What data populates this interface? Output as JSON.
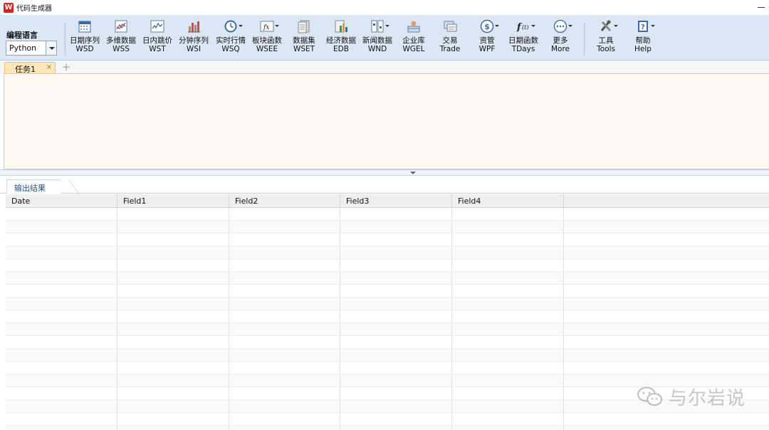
{
  "window": {
    "logo_letter": "W",
    "title": "代码生成器"
  },
  "ribbon": {
    "language_label": "编程语言",
    "language_value": "Python",
    "buttons": [
      {
        "label": "日期序列",
        "sub": "WSD",
        "icon": "calendar-grid-icon",
        "dropdown": false
      },
      {
        "label": "多维数据",
        "sub": "WSS",
        "icon": "multi-dimension-chart-icon",
        "dropdown": false
      },
      {
        "label": "日内跳价",
        "sub": "WST",
        "icon": "intraday-tick-icon",
        "dropdown": false
      },
      {
        "label": "分钟序列",
        "sub": "WSI",
        "icon": "bar-chart-icon",
        "dropdown": false
      },
      {
        "label": "实时行情",
        "sub": "WSQ",
        "icon": "clock-icon",
        "dropdown": true
      },
      {
        "label": "板块函数",
        "sub": "WSEE",
        "icon": "function-fx-icon",
        "dropdown": true
      },
      {
        "label": "数据集",
        "sub": "WSET",
        "icon": "dataset-stack-icon",
        "dropdown": false
      },
      {
        "label": "经济数据",
        "sub": "EDB",
        "icon": "economic-data-icon",
        "dropdown": false
      },
      {
        "label": "新闻数据",
        "sub": "WND",
        "icon": "news-icon",
        "dropdown": true
      },
      {
        "label": "企业库",
        "sub": "WGEL",
        "icon": "enterprise-library-icon",
        "dropdown": false
      },
      {
        "label": "交易",
        "sub": "Trade",
        "icon": "trade-window-icon",
        "dropdown": false
      },
      {
        "label": "资管",
        "sub": "WPF",
        "icon": "dollar-circle-icon",
        "dropdown": true
      },
      {
        "label": "日期函数",
        "sub": "TDays",
        "icon": "date-function-icon",
        "dropdown": true
      },
      {
        "label": "更多",
        "sub": "More",
        "icon": "more-ellipsis-icon",
        "dropdown": true
      },
      {
        "label": "工具",
        "sub": "Tools",
        "icon": "tools-wrench-icon",
        "dropdown": true
      },
      {
        "label": "帮助",
        "sub": "Help",
        "icon": "help-book-icon",
        "dropdown": true
      }
    ]
  },
  "tasks": {
    "tabs": [
      {
        "label": "任务1",
        "close": "×"
      }
    ],
    "add_symbol": "+"
  },
  "output": {
    "tab_label": "输出结果",
    "columns": [
      "Date",
      "Field1",
      "Field2",
      "Field3",
      "Field4",
      ""
    ]
  },
  "watermark": {
    "text": "与尔岩说"
  },
  "colors": {
    "ribbon_bg": "#dbe7f5",
    "task_tab_bg": "#fde7b8",
    "editor_bg": "#fdf8f1",
    "editor_border": "#f2c97c",
    "logo_red": "#e02020",
    "output_tab_text": "#23538c"
  }
}
